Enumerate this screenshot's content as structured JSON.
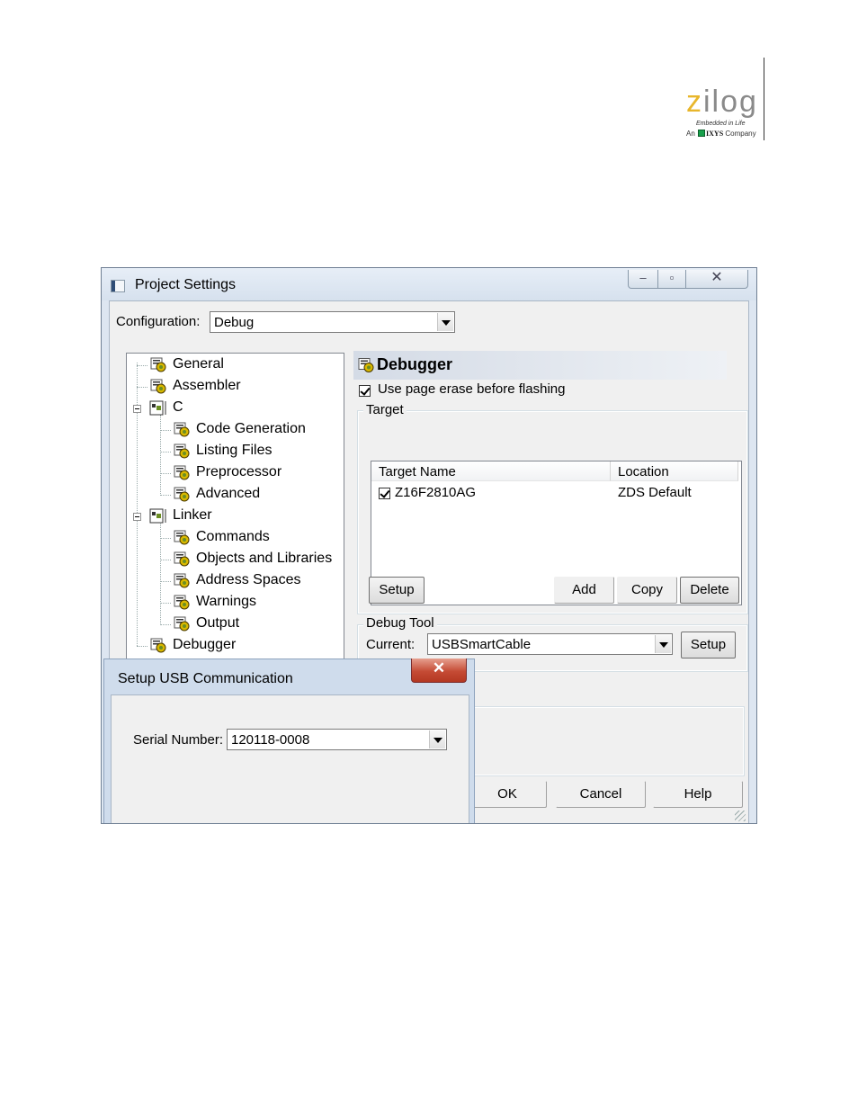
{
  "brand": {
    "wordmark_left": "z",
    "wordmark_right": "ilog",
    "tagline": "Embedded in Life",
    "company_prefix": "An",
    "company_name": "IXYS",
    "company_suffix": "Company"
  },
  "window": {
    "title": "Project Settings",
    "minimize_glyph": "–",
    "maximize_glyph": "▫",
    "close_glyph": "✕"
  },
  "configuration": {
    "label": "Configuration:",
    "value": "Debug"
  },
  "tree": {
    "general": "General",
    "assembler": "Assembler",
    "c": "C",
    "code_generation": "Code Generation",
    "listing_files": "Listing Files",
    "preprocessor": "Preprocessor",
    "advanced": "Advanced",
    "linker": "Linker",
    "commands": "Commands",
    "objects_libraries": "Objects and Libraries",
    "address_spaces": "Address Spaces",
    "warnings": "Warnings",
    "output": "Output",
    "debugger": "Debugger"
  },
  "panel": {
    "title": "Debugger",
    "page_erase_label": "Use page erase before flashing",
    "target_group": "Target",
    "columns": {
      "name": "Target Name",
      "location": "Location"
    },
    "targets": [
      {
        "name": "Z16F2810AG",
        "location": "ZDS Default"
      }
    ],
    "buttons": {
      "setup": "Setup",
      "add": "Add",
      "copy": "Copy",
      "delete": "Delete"
    },
    "debug_tool_group": "Debug Tool",
    "current_label": "Current:",
    "current_value": "USBSmartCable",
    "tool_setup": "Setup"
  },
  "footer": {
    "ok": "OK",
    "cancel": "Cancel",
    "help": "Help"
  },
  "usb_dialog": {
    "title": "Setup USB Communication",
    "close_glyph": "✕",
    "serial_label": "Serial Number:",
    "serial_value": "120118-0008"
  },
  "colors": {
    "brand_yellow": "#e8b62b",
    "brand_gray": "#8a8a8a",
    "ixys_green": "#18a04b",
    "close_red": "#c54b35"
  }
}
